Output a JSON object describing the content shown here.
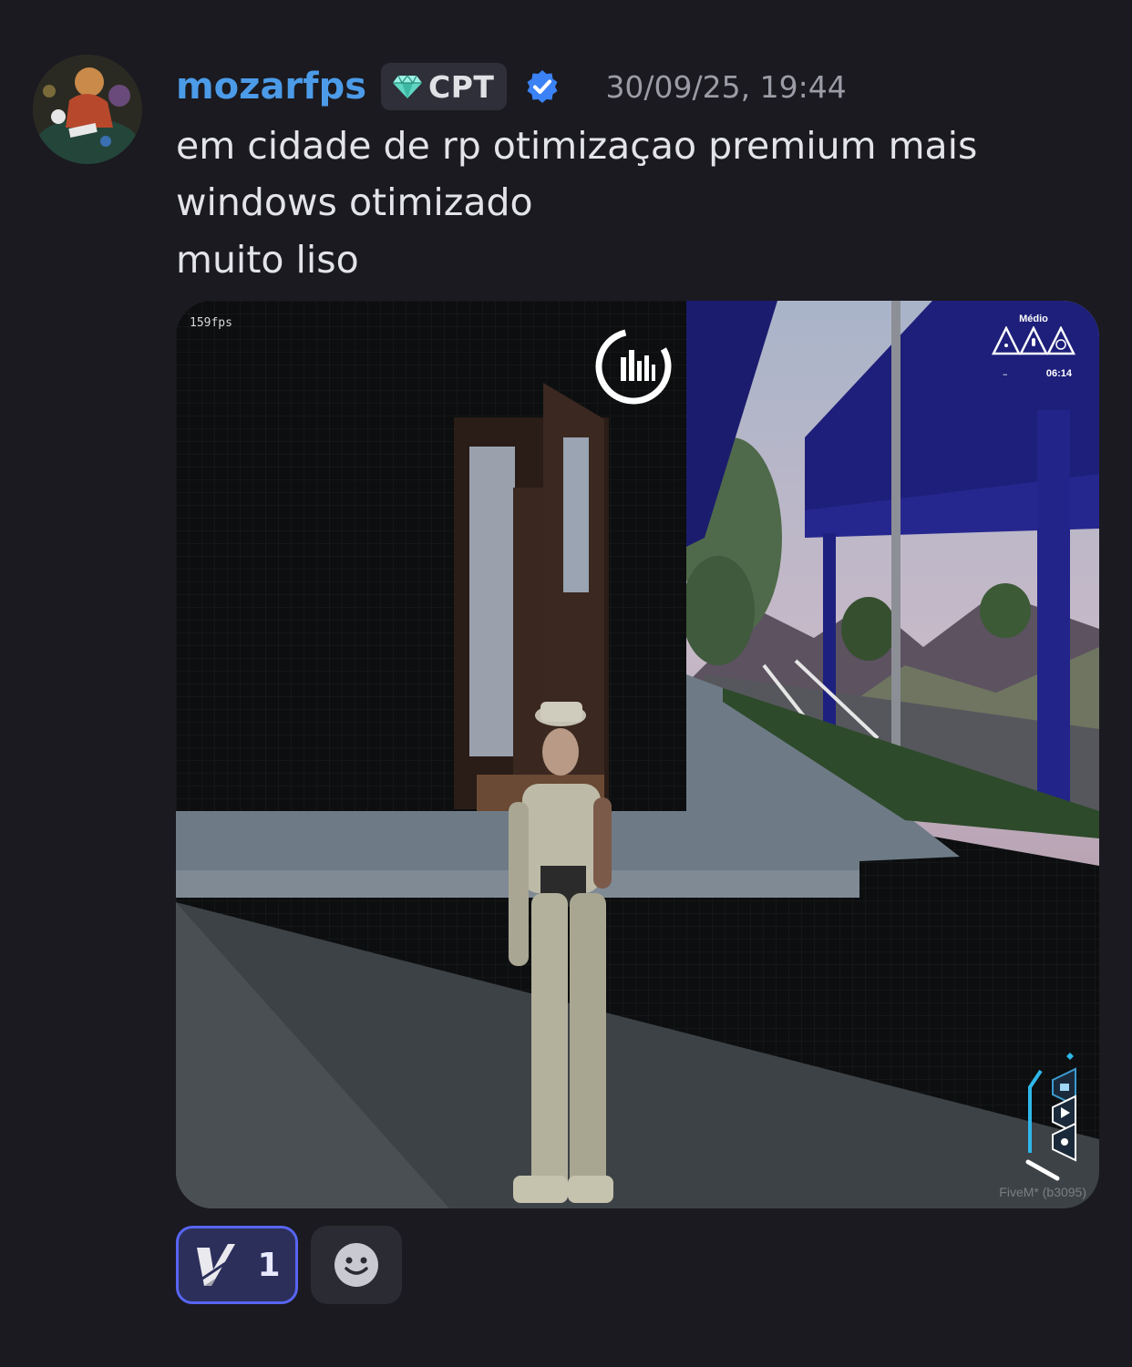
{
  "author": {
    "username": "mozarfps",
    "role_tag": "CPT",
    "role_icon": "diamond-gem-icon",
    "verified_icon": "verified-badge-icon",
    "timestamp": "30/09/25, 19:44"
  },
  "message": {
    "lines": [
      "em cidade de rp otimizaçao premium mais",
      "windows otimizado",
      "muito liso"
    ]
  },
  "attachment": {
    "fps": "159fps",
    "hud_mode": "Médio",
    "hud_clock": "06:14",
    "hud_dash": "–",
    "watermark": "FiveM* (b3095)"
  },
  "reactions": [
    {
      "emoji": "v-logo-emoji",
      "count": "1",
      "active": true
    }
  ],
  "add_reaction_icon": "smiley-icon",
  "colors": {
    "background": "#1a1a20",
    "username": "#4c9be8",
    "reaction_border": "#5865f2",
    "verified": "#3b82f6"
  }
}
